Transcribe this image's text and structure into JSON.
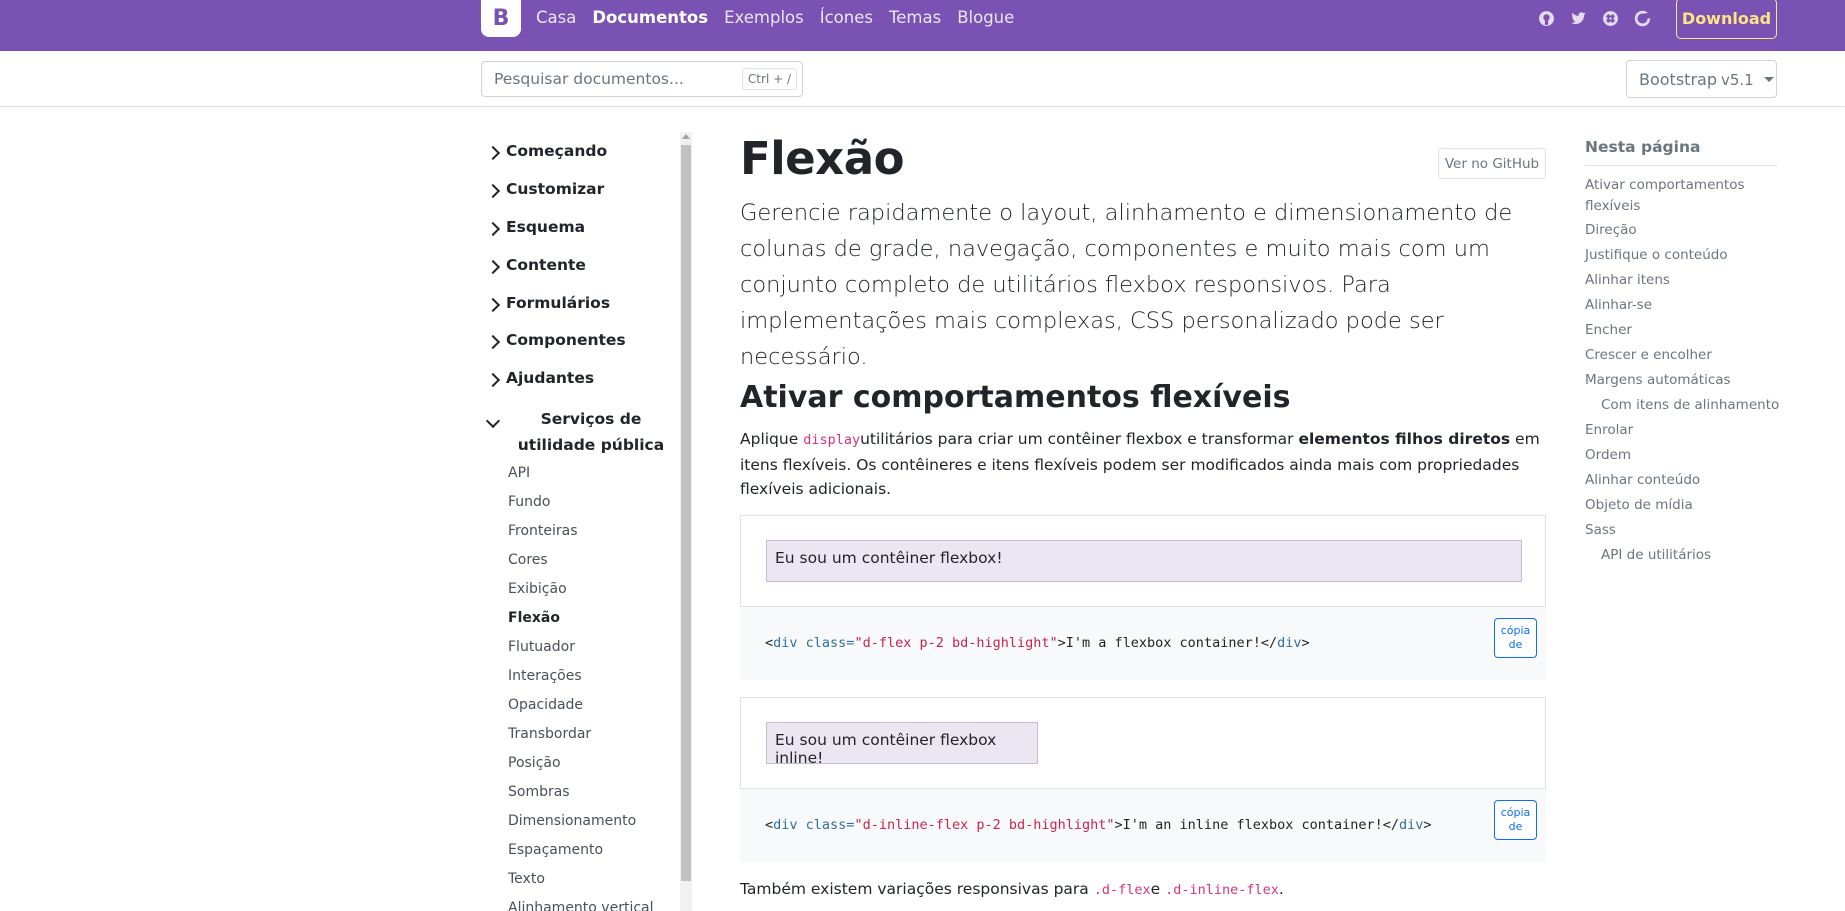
{
  "navbar": {
    "brand_letter": "B",
    "links": [
      "Casa",
      "Documentos",
      "Exemplos",
      "Ícones",
      "Temas",
      "Blogue"
    ],
    "active_link": "Documentos",
    "icons": [
      "github-icon",
      "twitter-icon",
      "slack-icon",
      "opencollective-icon"
    ],
    "download_label": "Download",
    "accent_color": "#7952b3",
    "download_color": "#ffe484"
  },
  "subbar": {
    "search_placeholder": "Pesquisar documentos...",
    "search_shortcut": "Ctrl + /",
    "version_label": "Bootstrap",
    "version_value": "v5.1"
  },
  "sidebar": {
    "sections": [
      "Começando",
      "Customizar",
      "Esquema",
      "Contente",
      "Formulários",
      "Componentes",
      "Ajudantes"
    ],
    "open_section": "Serviços de utilidade pública",
    "items": [
      "API",
      "Fundo",
      "Fronteiras",
      "Cores",
      "Exibição",
      "Flexão",
      "Flutuador",
      "Interações",
      "Opacidade",
      "Transbordar",
      "Posição",
      "Sombras",
      "Dimensionamento",
      "Espaçamento",
      "Texto",
      "Alinhamento vertical"
    ],
    "active_item": "Flexão"
  },
  "main": {
    "title": "Flexão",
    "github_button": "Ver no GitHub",
    "lead": "Gerencie rapidamente o layout, alinhamento e dimensionamento de colunas de grade, navegação, componentes e muito mais com um conjunto completo de utilitários flexbox responsivos. Para implementações mais complexas, CSS personalizado pode ser necessário.",
    "section_title": "Ativar comportamentos flexíveis",
    "para_prefix": "Aplique ",
    "para_code": "display",
    "para_mid": "utilitários para criar um contêiner flexbox e transformar ",
    "para_bold": "elementos filhos diretos",
    "para_suffix": " em itens flexíveis. Os contêineres e itens flexíveis podem ser modificados ainda mais com propriedades flexíveis adicionais.",
    "example1_text": "Eu sou um contêiner flexbox!",
    "code1": {
      "tag_open": "<div",
      "attr": " class=",
      "value": "\"d-flex p-2 bd-highlight\"",
      "content": ">I'm a flexbox container!</",
      "tag_close": "div",
      "end": ">"
    },
    "example2_text": "Eu sou um contêiner flexbox inline!",
    "code2": {
      "tag_open": "<div",
      "attr": " class=",
      "value": "\"d-inline-flex p-2 bd-highlight\"",
      "content": ">I'm an inline flexbox container!</",
      "tag_close": "div",
      "end": ">"
    },
    "copy_label_line1": "cópia",
    "copy_label_line2": "de",
    "bottom_prefix": "Também existem variações responsivas para ",
    "bottom_code1": ".d-flex",
    "bottom_mid": "e ",
    "bottom_code2": ".d-inline-flex",
    "bottom_end": "."
  },
  "toc": {
    "title": "Nesta página",
    "items": [
      {
        "label": "Ativar comportamentos flexíveis",
        "indent": false
      },
      {
        "label": "Direção",
        "indent": false
      },
      {
        "label": "Justifique o conteúdo",
        "indent": false
      },
      {
        "label": "Alinhar itens",
        "indent": false
      },
      {
        "label": "Alinhar-se",
        "indent": false
      },
      {
        "label": "Encher",
        "indent": false
      },
      {
        "label": "Crescer e encolher",
        "indent": false
      },
      {
        "label": "Margens automáticas",
        "indent": false
      },
      {
        "label": "Com itens de alinhamento",
        "indent": true
      },
      {
        "label": "Enrolar",
        "indent": false
      },
      {
        "label": "Ordem",
        "indent": false
      },
      {
        "label": "Alinhar conteúdo",
        "indent": false
      },
      {
        "label": "Objeto de mídia",
        "indent": false
      },
      {
        "label": "Sass",
        "indent": false
      },
      {
        "label": "API de utilitários",
        "indent": true
      }
    ]
  }
}
